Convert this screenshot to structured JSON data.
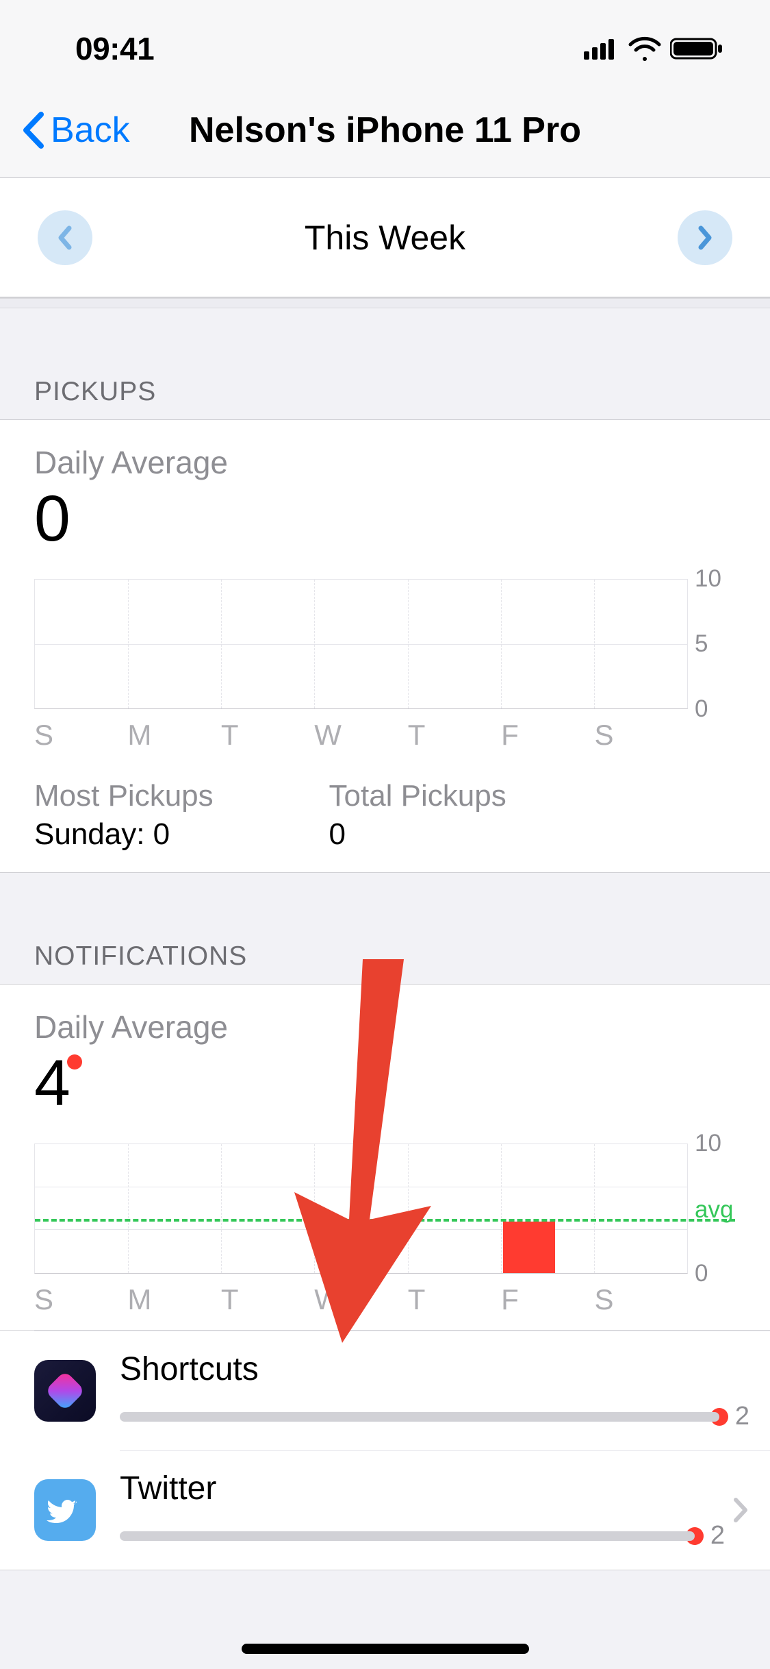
{
  "status": {
    "time": "09:41"
  },
  "nav": {
    "back": "Back",
    "title": "Nelson's iPhone 11 Pro"
  },
  "week": {
    "label": "This Week"
  },
  "pickups": {
    "header": "PICKUPS",
    "daily_avg_label": "Daily Average",
    "daily_avg_value": "0",
    "most_label": "Most Pickups",
    "most_value": "Sunday: 0",
    "total_label": "Total Pickups",
    "total_value": "0"
  },
  "notifications": {
    "header": "NOTIFICATIONS",
    "daily_avg_label": "Daily Average",
    "daily_avg_value": "4",
    "avg_label": "avg"
  },
  "x_ticks": [
    "S",
    "M",
    "T",
    "W",
    "T",
    "F",
    "S"
  ],
  "y_ticks": [
    "10",
    "5",
    "0"
  ],
  "y_ticks2": [
    "10",
    "0"
  ],
  "apps": {
    "shortcuts": {
      "name": "Shortcuts",
      "count": "2"
    },
    "twitter": {
      "name": "Twitter",
      "count": "2"
    }
  },
  "chart_data": [
    {
      "type": "bar",
      "title": "Pickups — Daily Average 0",
      "categories": [
        "S",
        "M",
        "T",
        "W",
        "T",
        "F",
        "S"
      ],
      "values": [
        0,
        0,
        0,
        0,
        0,
        0,
        0
      ],
      "ylim": [
        0,
        10
      ],
      "ylabel": "",
      "xlabel": ""
    },
    {
      "type": "bar",
      "title": "Notifications — Daily Average 4",
      "categories": [
        "S",
        "M",
        "T",
        "W",
        "T",
        "F",
        "S"
      ],
      "values": [
        0,
        0,
        0,
        0,
        0,
        4,
        0
      ],
      "avg": 4,
      "ylim": [
        0,
        10
      ],
      "ylabel": "",
      "xlabel": ""
    }
  ]
}
